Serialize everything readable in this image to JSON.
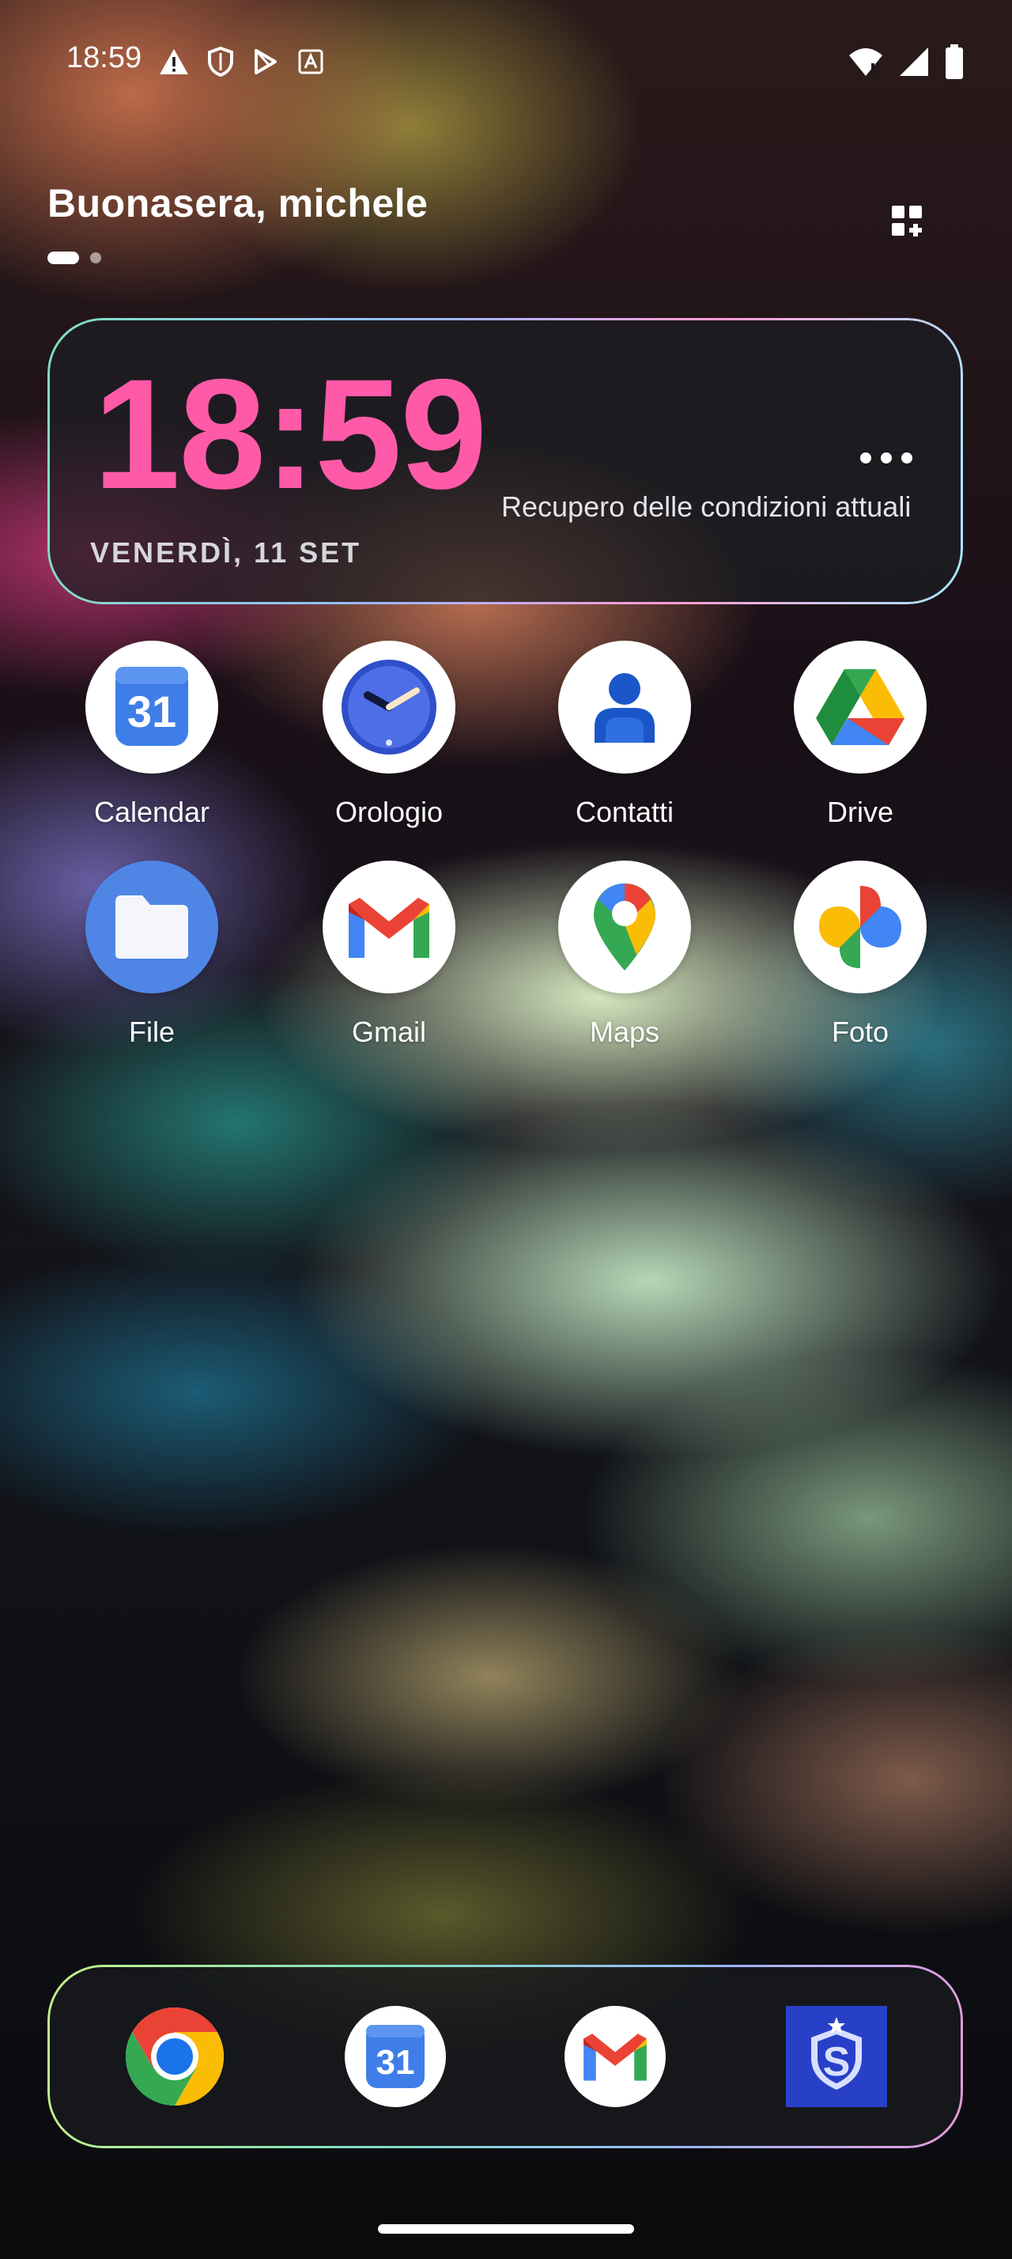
{
  "status_bar": {
    "time": "18:59",
    "left_icons": [
      "warning-icon",
      "shield-icon",
      "play-store-icon",
      "translate-icon"
    ],
    "right_icons": [
      "wifi-icon",
      "signal-icon",
      "battery-icon"
    ]
  },
  "greeting": "Buonasera, michele",
  "pages": {
    "count": 2,
    "active": 1
  },
  "clock_widget": {
    "time": "18:59",
    "date": "VENERDÌ, 11 SET",
    "weather_status": "Recupero delle condizioni attuali",
    "accent": "#ff5aa8"
  },
  "apps": [
    {
      "label": "Calendar",
      "icon": "calendar-icon",
      "day": "31"
    },
    {
      "label": "Orologio",
      "icon": "clock-icon"
    },
    {
      "label": "Contatti",
      "icon": "contacts-icon"
    },
    {
      "label": "Drive",
      "icon": "drive-icon"
    },
    {
      "label": "File",
      "icon": "files-icon"
    },
    {
      "label": "Gmail",
      "icon": "gmail-icon"
    },
    {
      "label": "Maps",
      "icon": "maps-icon"
    },
    {
      "label": "Foto",
      "icon": "photos-icon"
    }
  ],
  "dock": {
    "icons": [
      "chrome-icon",
      "calendar-icon",
      "gmail-icon",
      "security-shield-icon"
    ],
    "calendar_day": "31"
  }
}
